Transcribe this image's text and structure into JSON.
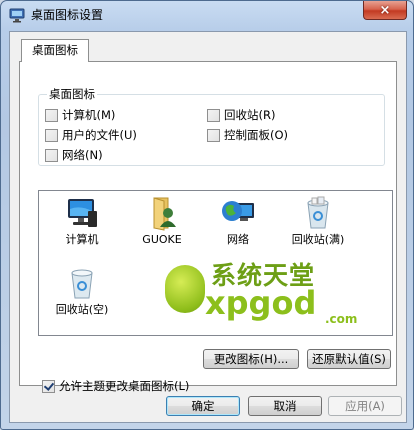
{
  "window": {
    "title": "桌面图标设置",
    "close_label": "×"
  },
  "tab": {
    "label": "桌面图标"
  },
  "group": {
    "label": "桌面图标",
    "checkboxes": [
      {
        "label": "计算机(M)",
        "checked": false
      },
      {
        "label": "回收站(R)",
        "checked": false
      },
      {
        "label": "用户的文件(U)",
        "checked": false
      },
      {
        "label": "控制面板(O)",
        "checked": false
      },
      {
        "label": "网络(N)",
        "checked": false
      }
    ]
  },
  "icons": [
    {
      "label": "计算机",
      "icon": "computer-icon"
    },
    {
      "label": "GUOKE",
      "icon": "user-folder-icon"
    },
    {
      "label": "网络",
      "icon": "network-globe-icon"
    },
    {
      "label": "回收站(满)",
      "icon": "recycle-bin-full-icon"
    },
    {
      "label": "回收站(空)",
      "icon": "recycle-bin-empty-icon"
    }
  ],
  "watermark": {
    "cn": "系统天堂",
    "en": "xpgod",
    "domain": ".com"
  },
  "buttons": {
    "change_icon": "更改图标(H)...",
    "restore_default": "还原默认值(S)",
    "ok": "确定",
    "cancel": "取消",
    "apply": "应用(A)"
  },
  "allow_themes": {
    "label": "允许主题更改桌面图标(L)",
    "checked": true
  },
  "colors": {
    "accent": "#3c7fb1",
    "close": "#c33a22",
    "watermark": "#8cbf1c"
  }
}
